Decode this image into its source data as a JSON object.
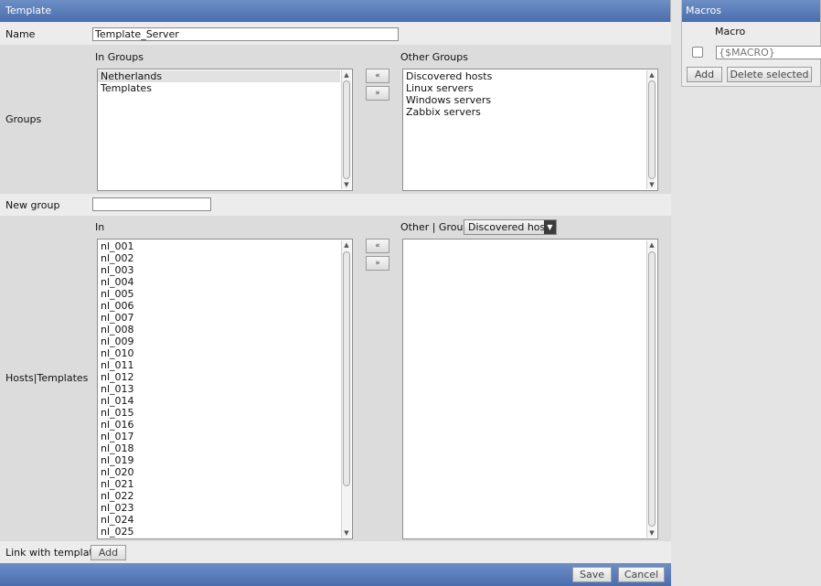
{
  "template": {
    "title": "Template",
    "name_label": "Name",
    "name_value": "Template_Server",
    "groups_label": "Groups",
    "in_groups_header": "In Groups",
    "other_groups_header": "Other Groups",
    "in_groups": [
      "Netherlands",
      "Templates"
    ],
    "other_groups": [
      "Discovered hosts",
      "Linux servers",
      "Windows servers",
      "Zabbix servers"
    ],
    "move_left": "«",
    "move_right": "»",
    "new_group_label": "New group",
    "new_group_value": "",
    "hosts_label": "Hosts|Templates",
    "in_header": "In",
    "other_group_label": "Other | Group",
    "group_select_value": "Discovered hosts",
    "hosts_in": [
      "nl_001",
      "nl_002",
      "nl_003",
      "nl_004",
      "nl_005",
      "nl_006",
      "nl_007",
      "nl_008",
      "nl_009",
      "nl_010",
      "nl_011",
      "nl_012",
      "nl_013",
      "nl_014",
      "nl_015",
      "nl_016",
      "nl_017",
      "nl_018",
      "nl_019",
      "nl_020",
      "nl_021",
      "nl_022",
      "nl_023",
      "nl_024",
      "nl_025"
    ],
    "hosts_other": [],
    "link_label": "Link with template",
    "add_label": "Add",
    "save_label": "Save",
    "cancel_label": "Cancel"
  },
  "macros": {
    "title": "Macros",
    "column_header": "Macro",
    "macro_placeholder": "{$MACRO}",
    "add_label": "Add",
    "delete_label": "Delete selected"
  },
  "colors": {
    "titlebar": "#4a6eae",
    "row_alt": "#dcdcdc",
    "row_plain": "#ececec"
  }
}
